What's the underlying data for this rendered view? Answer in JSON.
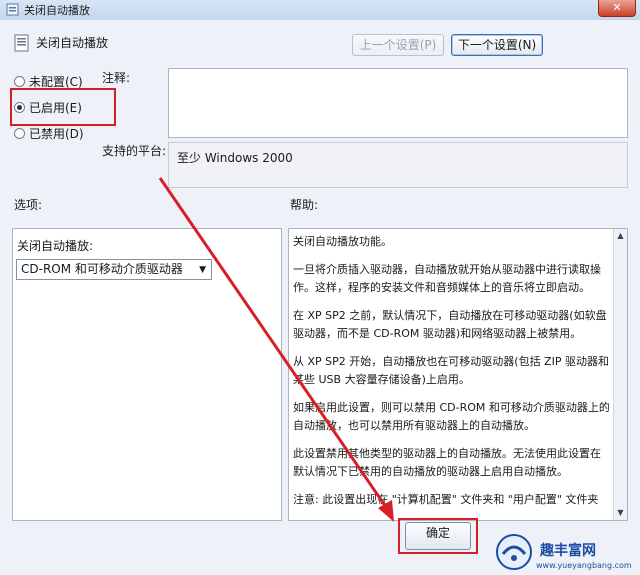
{
  "window": {
    "title": "关闭自动播放",
    "close_glyph": "✕"
  },
  "header": {
    "title": "关闭自动播放"
  },
  "nav": {
    "prev_label": "上一个设置(P)",
    "next_label": "下一个设置(N)"
  },
  "state_options": [
    {
      "label": "未配置(C)",
      "checked": false
    },
    {
      "label": "已启用(E)",
      "checked": true
    },
    {
      "label": "已禁用(D)",
      "checked": false
    }
  ],
  "comment": {
    "label": "注释:",
    "value": ""
  },
  "platform": {
    "label": "支持的平台:",
    "value": "至少 Windows 2000"
  },
  "options": {
    "section_label": "选项:",
    "field_label": "关闭自动播放:",
    "selected": "CD-ROM 和可移动介质驱动器"
  },
  "help": {
    "section_label": "帮助:",
    "paragraphs": [
      "关闭自动播放功能。",
      "一旦将介质插入驱动器，自动播放就开始从驱动器中进行读取操作。这样，程序的安装文件和音频媒体上的音乐将立即启动。",
      "在 XP SP2 之前，默认情况下，自动播放在可移动驱动器(如软盘驱动器，而不是 CD-ROM 驱动器)和网络驱动器上被禁用。",
      "从 XP SP2 开始，自动播放也在可移动驱动器(包括 ZIP 驱动器和某些 USB 大容量存储设备)上启用。",
      "如果启用此设置，则可以禁用 CD-ROM 和可移动介质驱动器上的自动播放，也可以禁用所有驱动器上的自动播放。",
      "此设置禁用其他类型的驱动器上的自动播放。无法使用此设置在默认情况下已禁用的自动播放的驱动器上启用自动播放。",
      "注意: 此设置出现在 \"计算机配置\" 文件夹和 \"用户配置\" 文件夹"
    ]
  },
  "footer": {
    "ok_label": "确定"
  },
  "watermark": {
    "title": "趣丰富网",
    "url": "www.yueyangbang.com"
  },
  "colors": {
    "annotation_red": "#d81f26",
    "watermark_blue": "#1a4ea3"
  }
}
